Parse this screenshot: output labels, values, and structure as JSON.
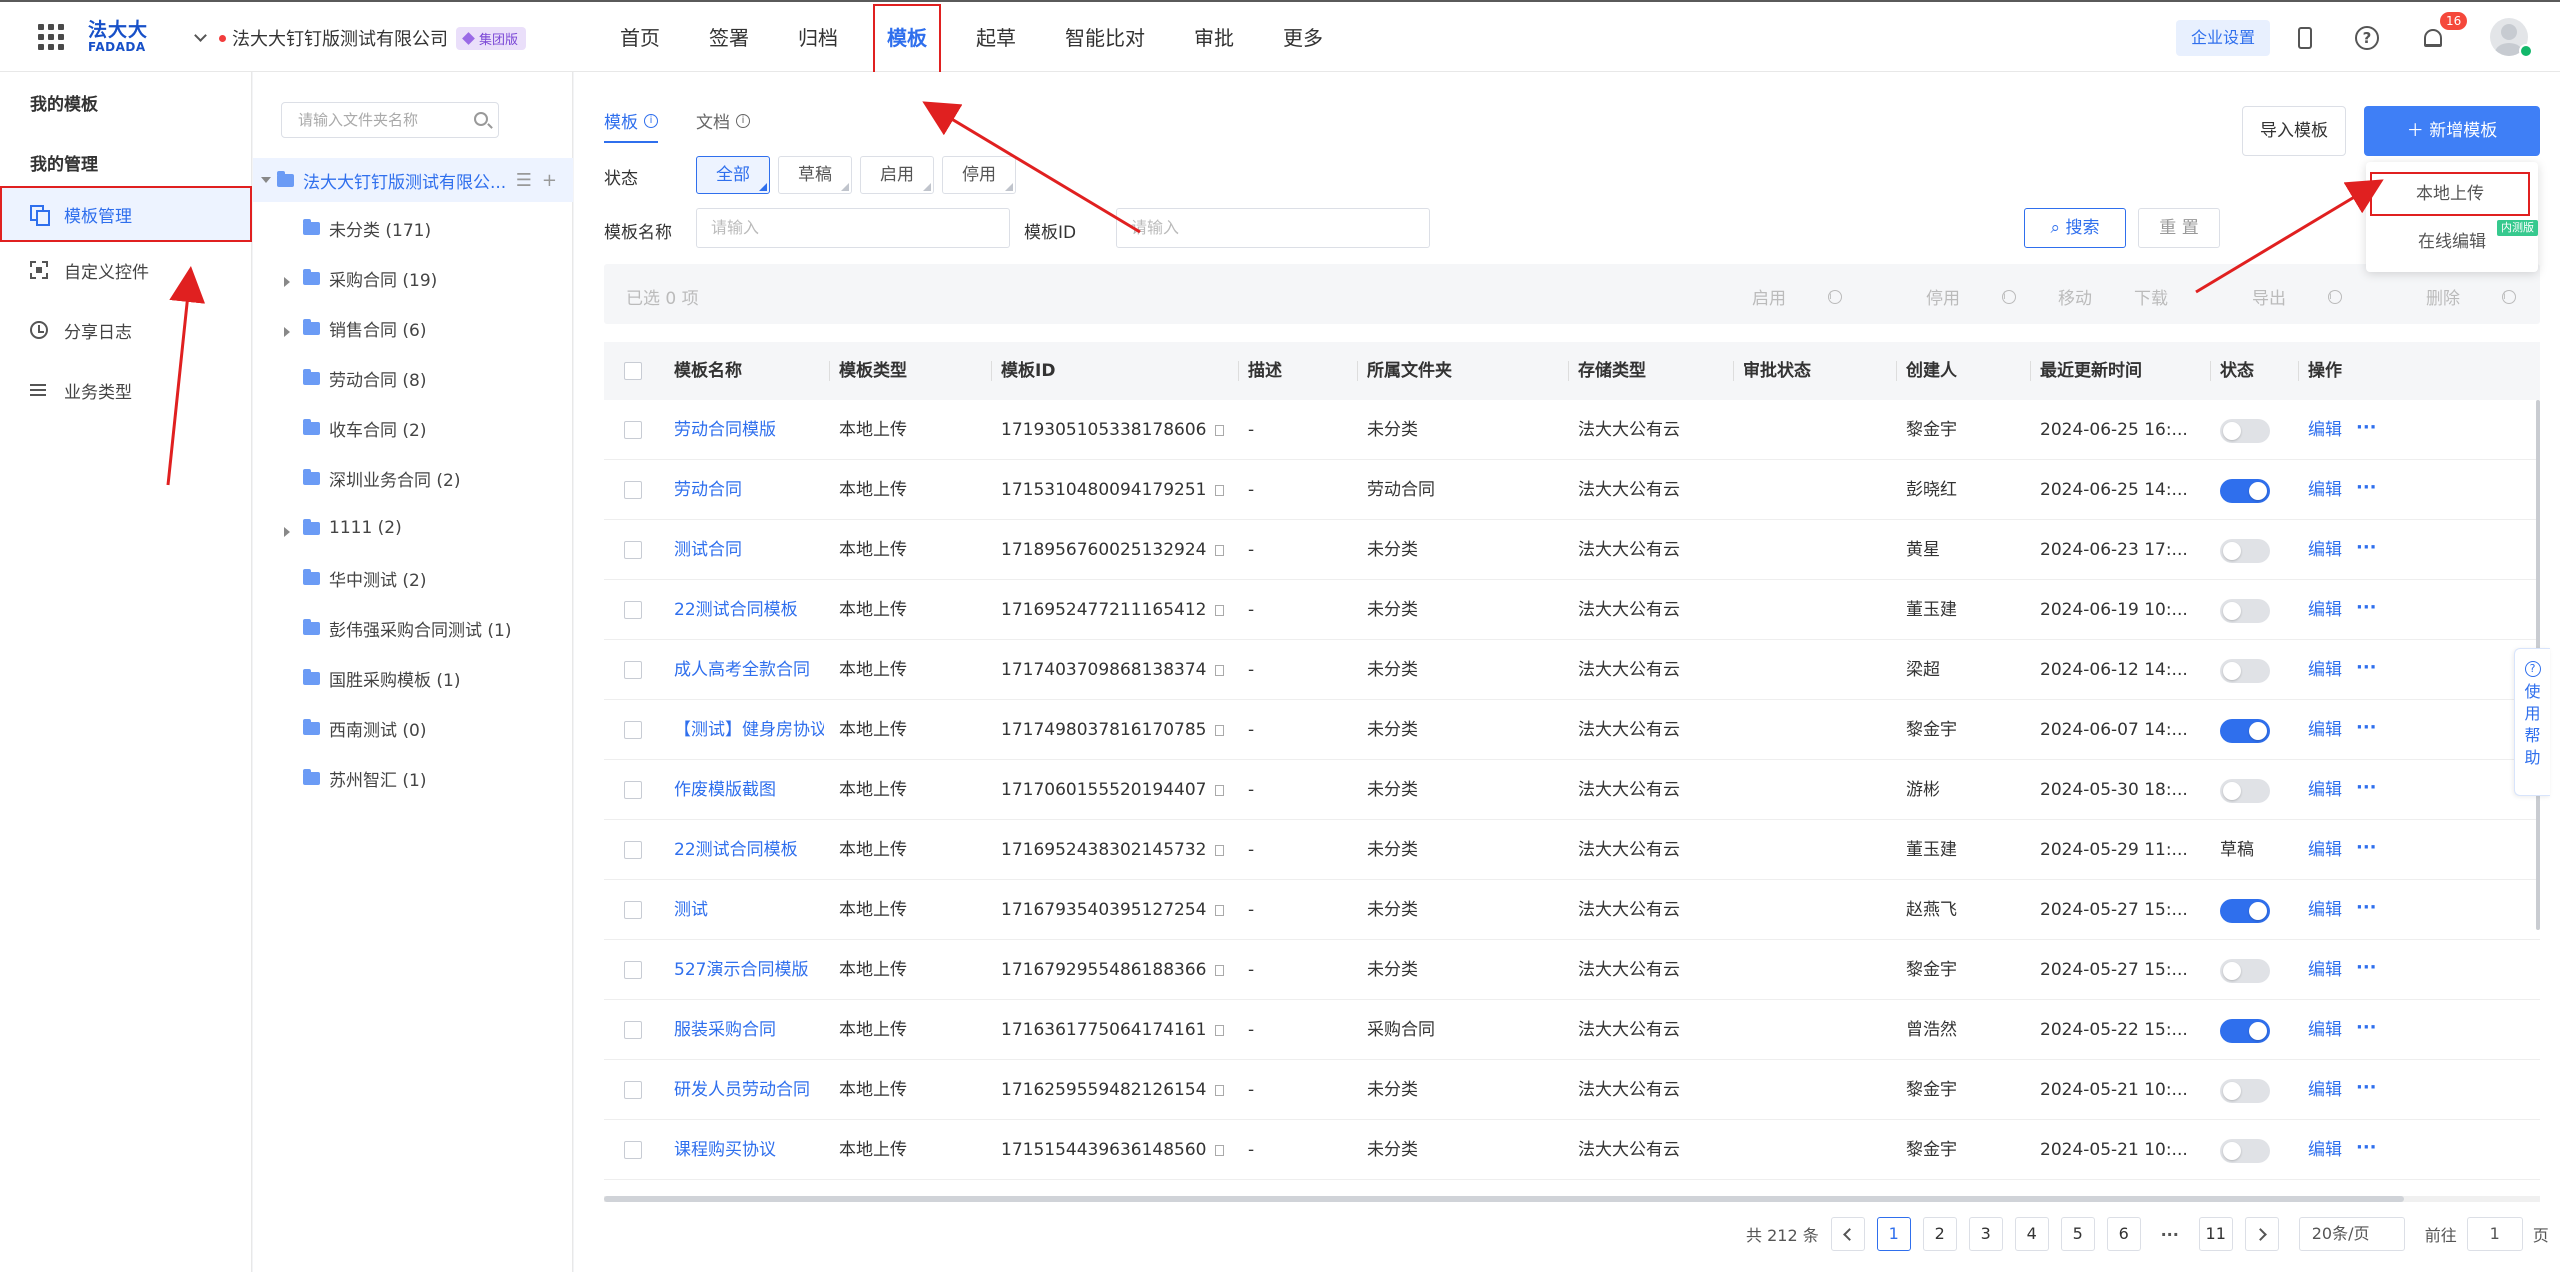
{
  "header": {
    "logo_cn": "法大大",
    "logo_en": "FADADA",
    "company": "法大大钉钉版测试有限公司",
    "edition_badge": "集团版",
    "nav": [
      "首页",
      "签署",
      "归档",
      "模板",
      "起草",
      "智能比对",
      "审批",
      "更多"
    ],
    "active_nav": "模板",
    "corp_settings": "企业设置",
    "notification_count": "16"
  },
  "sidebar": {
    "title_my_templates": "我的模板",
    "title_my_management": "我的管理",
    "items": [
      {
        "label": "模板管理",
        "icon": "template-icon"
      },
      {
        "label": "自定义控件",
        "icon": "custom-control-icon"
      },
      {
        "label": "分享日志",
        "icon": "clock-icon"
      },
      {
        "label": "业务类型",
        "icon": "list-icon"
      }
    ]
  },
  "folders": {
    "search_placeholder": "请输入文件夹名称",
    "root": "法大大钉钉版测试有限公...",
    "items": [
      {
        "label": "未分类 (171)",
        "expandable": false
      },
      {
        "label": "采购合同 (19)",
        "expandable": true
      },
      {
        "label": "销售合同 (6)",
        "expandable": true
      },
      {
        "label": "劳动合同 (8)",
        "expandable": false
      },
      {
        "label": "收车合同 (2)",
        "expandable": false
      },
      {
        "label": "深圳业务合同 (2)",
        "expandable": false
      },
      {
        "label": "1111 (2)",
        "expandable": true
      },
      {
        "label": "华中测试 (2)",
        "expandable": false
      },
      {
        "label": "彭伟强采购合同测试 (1)",
        "expandable": false
      },
      {
        "label": "国胜采购模板 (1)",
        "expandable": false
      },
      {
        "label": "西南测试 (0)",
        "expandable": false
      },
      {
        "label": "苏州智汇 (1)",
        "expandable": false
      }
    ]
  },
  "content": {
    "tabs": [
      "模板",
      "文档"
    ],
    "status_label": "状态",
    "status_chips": [
      "全部",
      "草稿",
      "启用",
      "停用"
    ],
    "name_label": "模板名称",
    "name_placeholder": "请输入",
    "id_label": "模板ID",
    "id_placeholder": "请输入",
    "search_btn": "搜索",
    "reset_btn": "重 置",
    "import_btn": "导入模板",
    "new_btn": "新增模板",
    "dropdown": [
      "本地上传",
      "在线编辑"
    ],
    "beta_badge": "内测版",
    "selected_text": "已选  0  项",
    "bulk_actions": [
      "启用",
      "停用",
      "移动",
      "下载",
      "导出",
      "删除"
    ]
  },
  "table": {
    "columns": [
      "模板名称",
      "模板类型",
      "模板ID",
      "描述",
      "所属文件夹",
      "存储类型",
      "审批状态",
      "创建人",
      "最近更新时间",
      "状态",
      "操作"
    ],
    "edit_label": "编辑",
    "rows": [
      {
        "name": "劳动合同模版",
        "type": "本地上传",
        "id": "1719305105338178606",
        "desc": "-",
        "folder": "未分类",
        "storage": "法大大公有云",
        "approval": "",
        "creator": "黎金宇",
        "updated": "2024-06-25 16:...",
        "status": "off"
      },
      {
        "name": "劳动合同",
        "type": "本地上传",
        "id": "1715310480094179251",
        "desc": "-",
        "folder": "劳动合同",
        "storage": "法大大公有云",
        "approval": "",
        "creator": "彭晓红",
        "updated": "2024-06-25 14:...",
        "status": "on"
      },
      {
        "name": "测试合同",
        "type": "本地上传",
        "id": "1718956760025132924",
        "desc": "-",
        "folder": "未分类",
        "storage": "法大大公有云",
        "approval": "",
        "creator": "黄星",
        "updated": "2024-06-23 17:...",
        "status": "off"
      },
      {
        "name": "22测试合同模板",
        "type": "本地上传",
        "id": "1716952477211165412",
        "desc": "-",
        "folder": "未分类",
        "storage": "法大大公有云",
        "approval": "",
        "creator": "董玉建",
        "updated": "2024-06-19 10:...",
        "status": "off"
      },
      {
        "name": "成人高考全款合同",
        "type": "本地上传",
        "id": "1717403709868138374",
        "desc": "-",
        "folder": "未分类",
        "storage": "法大大公有云",
        "approval": "",
        "creator": "梁超",
        "updated": "2024-06-12 14:...",
        "status": "off"
      },
      {
        "name": "【测试】健身房协议",
        "type": "本地上传",
        "id": "1717498037816170785",
        "desc": "-",
        "folder": "未分类",
        "storage": "法大大公有云",
        "approval": "",
        "creator": "黎金宇",
        "updated": "2024-06-07 14:...",
        "status": "on"
      },
      {
        "name": "作废模版截图",
        "type": "本地上传",
        "id": "1717060155520194407",
        "desc": "-",
        "folder": "未分类",
        "storage": "法大大公有云",
        "approval": "",
        "creator": "游彬",
        "updated": "2024-05-30 18:...",
        "status": "off"
      },
      {
        "name": "22测试合同模板",
        "type": "本地上传",
        "id": "1716952438302145732",
        "desc": "-",
        "folder": "未分类",
        "storage": "法大大公有云",
        "approval": "",
        "creator": "董玉建",
        "updated": "2024-05-29 11:...",
        "status": "草稿"
      },
      {
        "name": "测试",
        "type": "本地上传",
        "id": "1716793540395127254",
        "desc": "-",
        "folder": "未分类",
        "storage": "法大大公有云",
        "approval": "",
        "creator": "赵燕飞",
        "updated": "2024-05-27 15:...",
        "status": "on"
      },
      {
        "name": "527演示合同模版",
        "type": "本地上传",
        "id": "1716792955486188366",
        "desc": "-",
        "folder": "未分类",
        "storage": "法大大公有云",
        "approval": "",
        "creator": "黎金宇",
        "updated": "2024-05-27 15:...",
        "status": "off"
      },
      {
        "name": "服装采购合同",
        "type": "本地上传",
        "id": "1716361775064174161",
        "desc": "-",
        "folder": "采购合同",
        "storage": "法大大公有云",
        "approval": "",
        "creator": "曾浩然",
        "updated": "2024-05-22 15:...",
        "status": "on"
      },
      {
        "name": "研发人员劳动合同",
        "type": "本地上传",
        "id": "1716259559482126154",
        "desc": "-",
        "folder": "未分类",
        "storage": "法大大公有云",
        "approval": "",
        "creator": "黎金宇",
        "updated": "2024-05-21 10:...",
        "status": "off"
      },
      {
        "name": "课程购买协议",
        "type": "本地上传",
        "id": "1715154439636148560",
        "desc": "-",
        "folder": "未分类",
        "storage": "法大大公有云",
        "approval": "",
        "creator": "黎金宇",
        "updated": "2024-05-21 10:...",
        "status": "off"
      }
    ]
  },
  "pagination": {
    "total": "共 212 条",
    "pages": [
      "1",
      "2",
      "3",
      "4",
      "5",
      "6"
    ],
    "last_page": "11",
    "page_size": "20条/页",
    "goto_label": "前往",
    "goto_value": "1",
    "goto_unit": "页"
  },
  "help_tab": "使用帮助",
  "colors": {
    "accent": "#2f6fed",
    "annotation": "#e02020"
  }
}
